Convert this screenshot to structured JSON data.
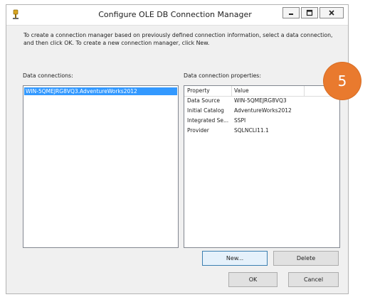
{
  "window": {
    "title": "Configure OLE DB Connection Manager"
  },
  "intro_text": "To create a connection manager based on previously defined connection information, select a data connection, and then click OK. To create a new connection manager, click New.",
  "data_connections": {
    "label": "Data connections:",
    "items": [
      "WIN-5QMEJRG8VQ3.AdventureWorks2012"
    ]
  },
  "properties": {
    "label": "Data connection properties:",
    "header": {
      "property": "Property",
      "value": "Value"
    },
    "rows": [
      {
        "key": "Data Source",
        "value": "WIN-5QMEJRG8VQ3"
      },
      {
        "key": "Initial Catalog",
        "value": "AdventureWorks2012"
      },
      {
        "key": "Integrated Se...",
        "value": "SSPI"
      },
      {
        "key": "Provider",
        "value": "SQLNCLI11.1"
      }
    ]
  },
  "buttons": {
    "new": "New...",
    "delete": "Delete",
    "ok": "OK",
    "cancel": "Cancel"
  },
  "badge": {
    "number": "5",
    "color": "#e97a2e"
  },
  "icons": {
    "app": "connection-manager-icon",
    "minimize": "minimize-icon",
    "maximize": "maximize-icon",
    "close": "close-icon"
  },
  "colors": {
    "selection": "#3399ff",
    "badge": "#e97a2e",
    "button_border": "#adadad"
  }
}
